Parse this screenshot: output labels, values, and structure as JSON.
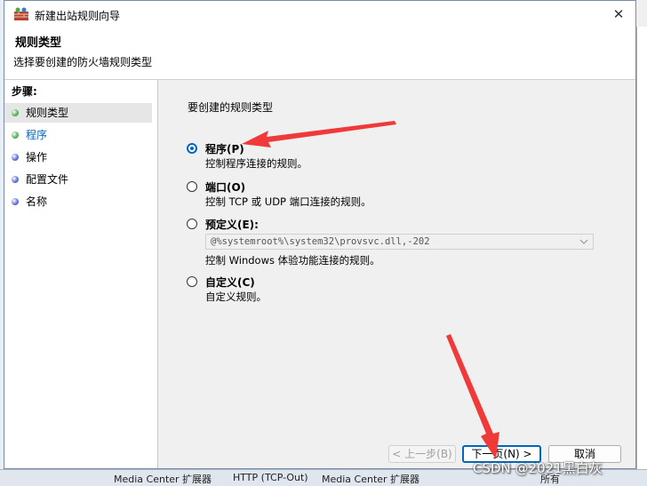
{
  "background": {
    "taskbar_row": [
      "Media Center 扩展器",
      "HTTP (TCP-Out)",
      "Media Center 扩展器",
      "所有"
    ]
  },
  "dialog": {
    "title": "新建出站规则向导",
    "close_label": "✕",
    "header_title": "规则类型",
    "header_subtitle": "选择要创建的防火墙规则类型"
  },
  "steps": {
    "title": "步骤:",
    "items": [
      {
        "label": "规则类型",
        "dot_color": "#4caf50"
      },
      {
        "label": "程序",
        "dot_color": "#4caf50"
      },
      {
        "label": "操作",
        "dot_color": "#5a6bd6"
      },
      {
        "label": "配置文件",
        "dot_color": "#5a6bd6"
      },
      {
        "label": "名称",
        "dot_color": "#5a6bd6"
      }
    ]
  },
  "content": {
    "prompt": "要创建的规则类型",
    "options": [
      {
        "label": "程序(P)",
        "desc": "控制程序连接的规则。",
        "checked": true
      },
      {
        "label": "端口(O)",
        "desc": "控制 TCP 或 UDP 端口连接的规则。",
        "checked": false
      },
      {
        "label": "预定义(E):",
        "desc": "控制 Windows 体验功能连接的规则。",
        "checked": false
      },
      {
        "label": "自定义(C)",
        "desc": "自定义规则。",
        "checked": false
      }
    ],
    "predefined_value": "@%systemroot%\\system32\\provsvc.dll,-202"
  },
  "buttons": {
    "back": "< 上一步(B)",
    "next": "下一页(N) >",
    "cancel": "取消"
  },
  "watermark": "CSDN @2021黑白灰",
  "colors": {
    "accent": "#0067c0",
    "arrow": "#f03a3a"
  }
}
